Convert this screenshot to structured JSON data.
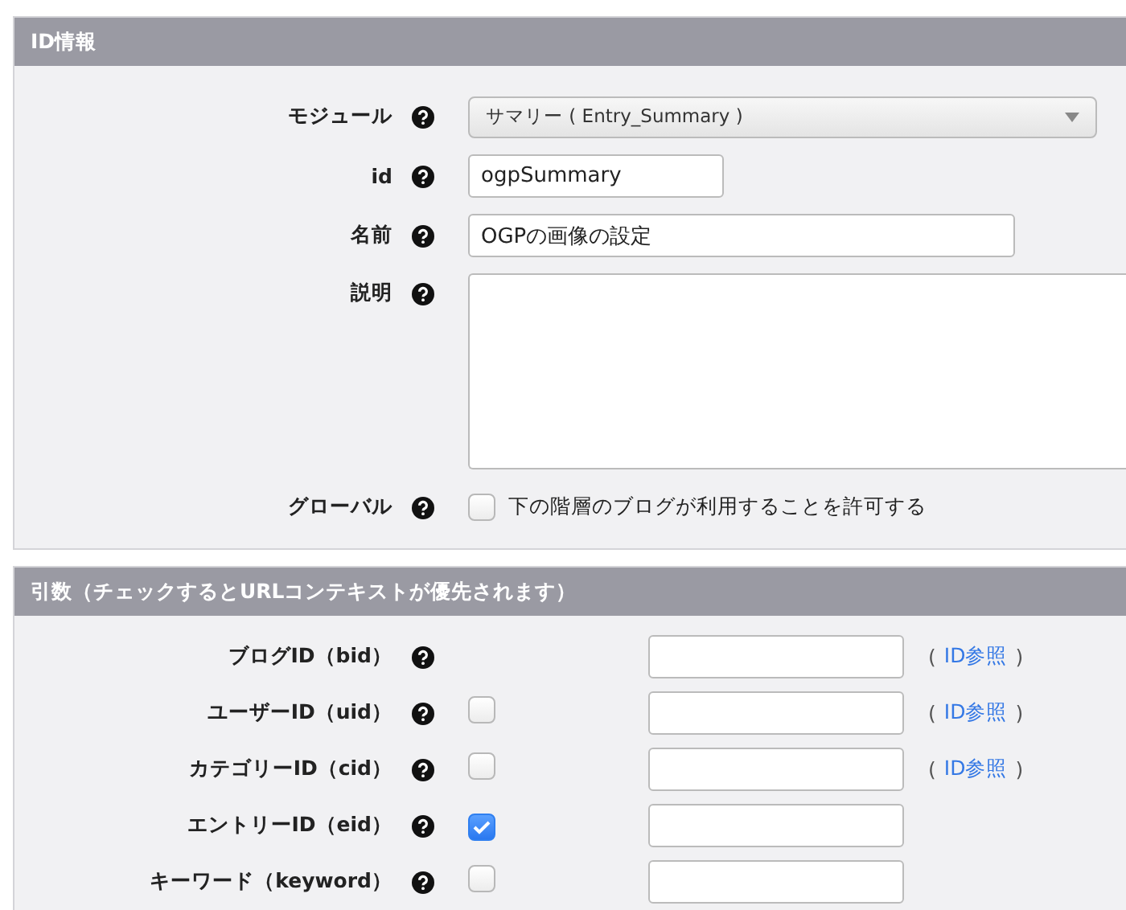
{
  "id_section": {
    "title": "ID情報",
    "module": {
      "label": "モジュール",
      "value": "サマリー ( Entry_Summary )"
    },
    "id": {
      "label": "id",
      "value": "ogpSummary"
    },
    "name": {
      "label": "名前",
      "value": "OGPの画像の設定"
    },
    "description": {
      "label": "説明"
    },
    "global": {
      "label": "グローバル",
      "checked": false,
      "text": "下の階層のブログが利用することを許可する"
    }
  },
  "args_section": {
    "title": "引数（チェックするとURLコンテキストが優先されます）",
    "rows": [
      {
        "label": "ブログID（bid）",
        "kind": "plain",
        "ref": {
          "open": "(",
          "link": "ID参照",
          "close": ")"
        }
      },
      {
        "label": "ユーザーID（uid）",
        "kind": "checkable",
        "checked": false,
        "ref": {
          "open": "(",
          "link": "ID参照",
          "close": ")"
        }
      },
      {
        "label": "カテゴリーID（cid）",
        "kind": "checkable",
        "checked": false,
        "ref": {
          "open": "(",
          "link": "ID参照",
          "close": ")"
        }
      },
      {
        "label": "エントリーID（eid）",
        "kind": "checkable",
        "checked": true
      },
      {
        "label": "キーワード（keyword）",
        "kind": "checkable",
        "checked": false
      }
    ]
  }
}
